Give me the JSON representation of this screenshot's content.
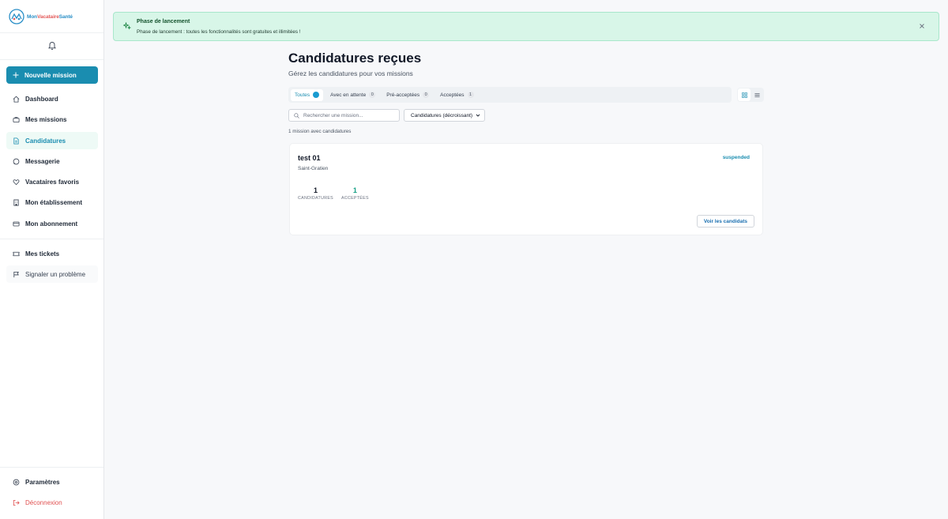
{
  "app": {
    "logo": {
      "part1": "Mon",
      "part2": "Vacataire",
      "part3": "Santé"
    }
  },
  "sidebar": {
    "new_mission": "Nouvelle mission",
    "items": [
      {
        "label": "Dashboard",
        "icon": "home-icon"
      },
      {
        "label": "Mes missions",
        "icon": "briefcase-icon"
      },
      {
        "label": "Candidatures",
        "icon": "file-icon"
      },
      {
        "label": "Messagerie",
        "icon": "message-icon"
      },
      {
        "label": "Vacataires favoris",
        "icon": "heart-icon"
      },
      {
        "label": "Mon établissement",
        "icon": "building-icon"
      },
      {
        "label": "Mon abonnement",
        "icon": "card-icon"
      }
    ],
    "tickets": "Mes tickets",
    "report": "Signaler un problème",
    "settings": "Paramètres",
    "logout": "Déconnexion"
  },
  "banner": {
    "title": "Phase de lancement",
    "text": "Phase de lancement : toutes les fonctionnalités sont gratuites et illimitées !"
  },
  "main": {
    "title": "Candidatures reçues",
    "subtitle": "Gérez les candidatures pour vos missions",
    "tabs": [
      {
        "label": "Toutes",
        "count": "1",
        "active": true
      },
      {
        "label": "Avec en attente",
        "count": "0"
      },
      {
        "label": "Pré-acceptées",
        "count": "0"
      },
      {
        "label": "Acceptées",
        "count": "1"
      }
    ],
    "search_placeholder": "Rechercher une mission...",
    "sort_label": "Candidatures (décroissant)",
    "result_count": "1 mission avec candidatures"
  },
  "card": {
    "title": "test 01",
    "location": "Saint-Gratien",
    "status": "suspended",
    "stats": [
      {
        "value": "1",
        "label": "CANDIDATURES"
      },
      {
        "value": "1",
        "label": "ACCEPTÉES"
      }
    ],
    "button": "Voir les candidats"
  },
  "colors": {
    "accent": "#1a8db0",
    "banner_bg": "#d8f6e8",
    "danger": "#e04f4f"
  }
}
